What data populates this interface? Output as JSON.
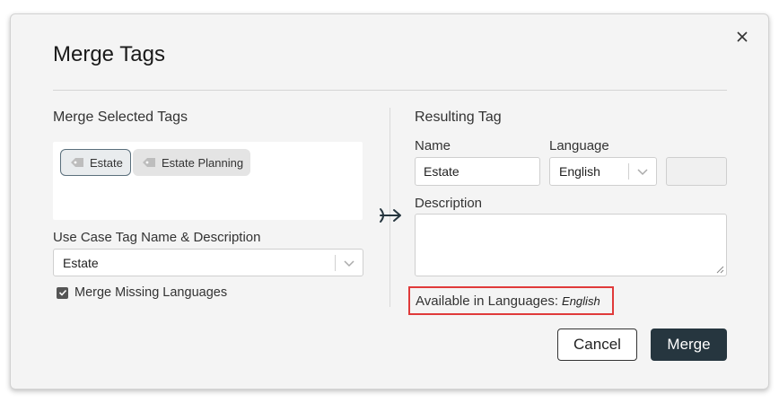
{
  "dialog": {
    "title": "Merge Tags"
  },
  "left": {
    "section_title": "Merge Selected Tags",
    "tags": [
      {
        "label": "Estate",
        "selected": true
      },
      {
        "label": "Estate Planning",
        "selected": false
      }
    ],
    "use_case_label": "Use Case Tag Name & Description",
    "use_case_value": "Estate",
    "merge_missing_label": "Merge Missing Languages",
    "merge_missing_checked": true
  },
  "right": {
    "section_title": "Resulting Tag",
    "name_label": "Name",
    "name_value": "Estate",
    "language_label": "Language",
    "language_value": "English",
    "description_label": "Description",
    "description_value": "",
    "available_label": "Available in Languages:",
    "available_value": "English"
  },
  "actions": {
    "cancel_label": "Cancel",
    "merge_label": "Merge"
  },
  "colors": {
    "primary": "#26363f",
    "highlight": "#e03a3a",
    "modal_bg": "#f4f4f4"
  },
  "icons": {
    "close": "close-icon",
    "tag": "tag-icon",
    "chevron": "chevron-down-icon",
    "arrow": "merge-arrow-icon",
    "check": "check-icon"
  }
}
